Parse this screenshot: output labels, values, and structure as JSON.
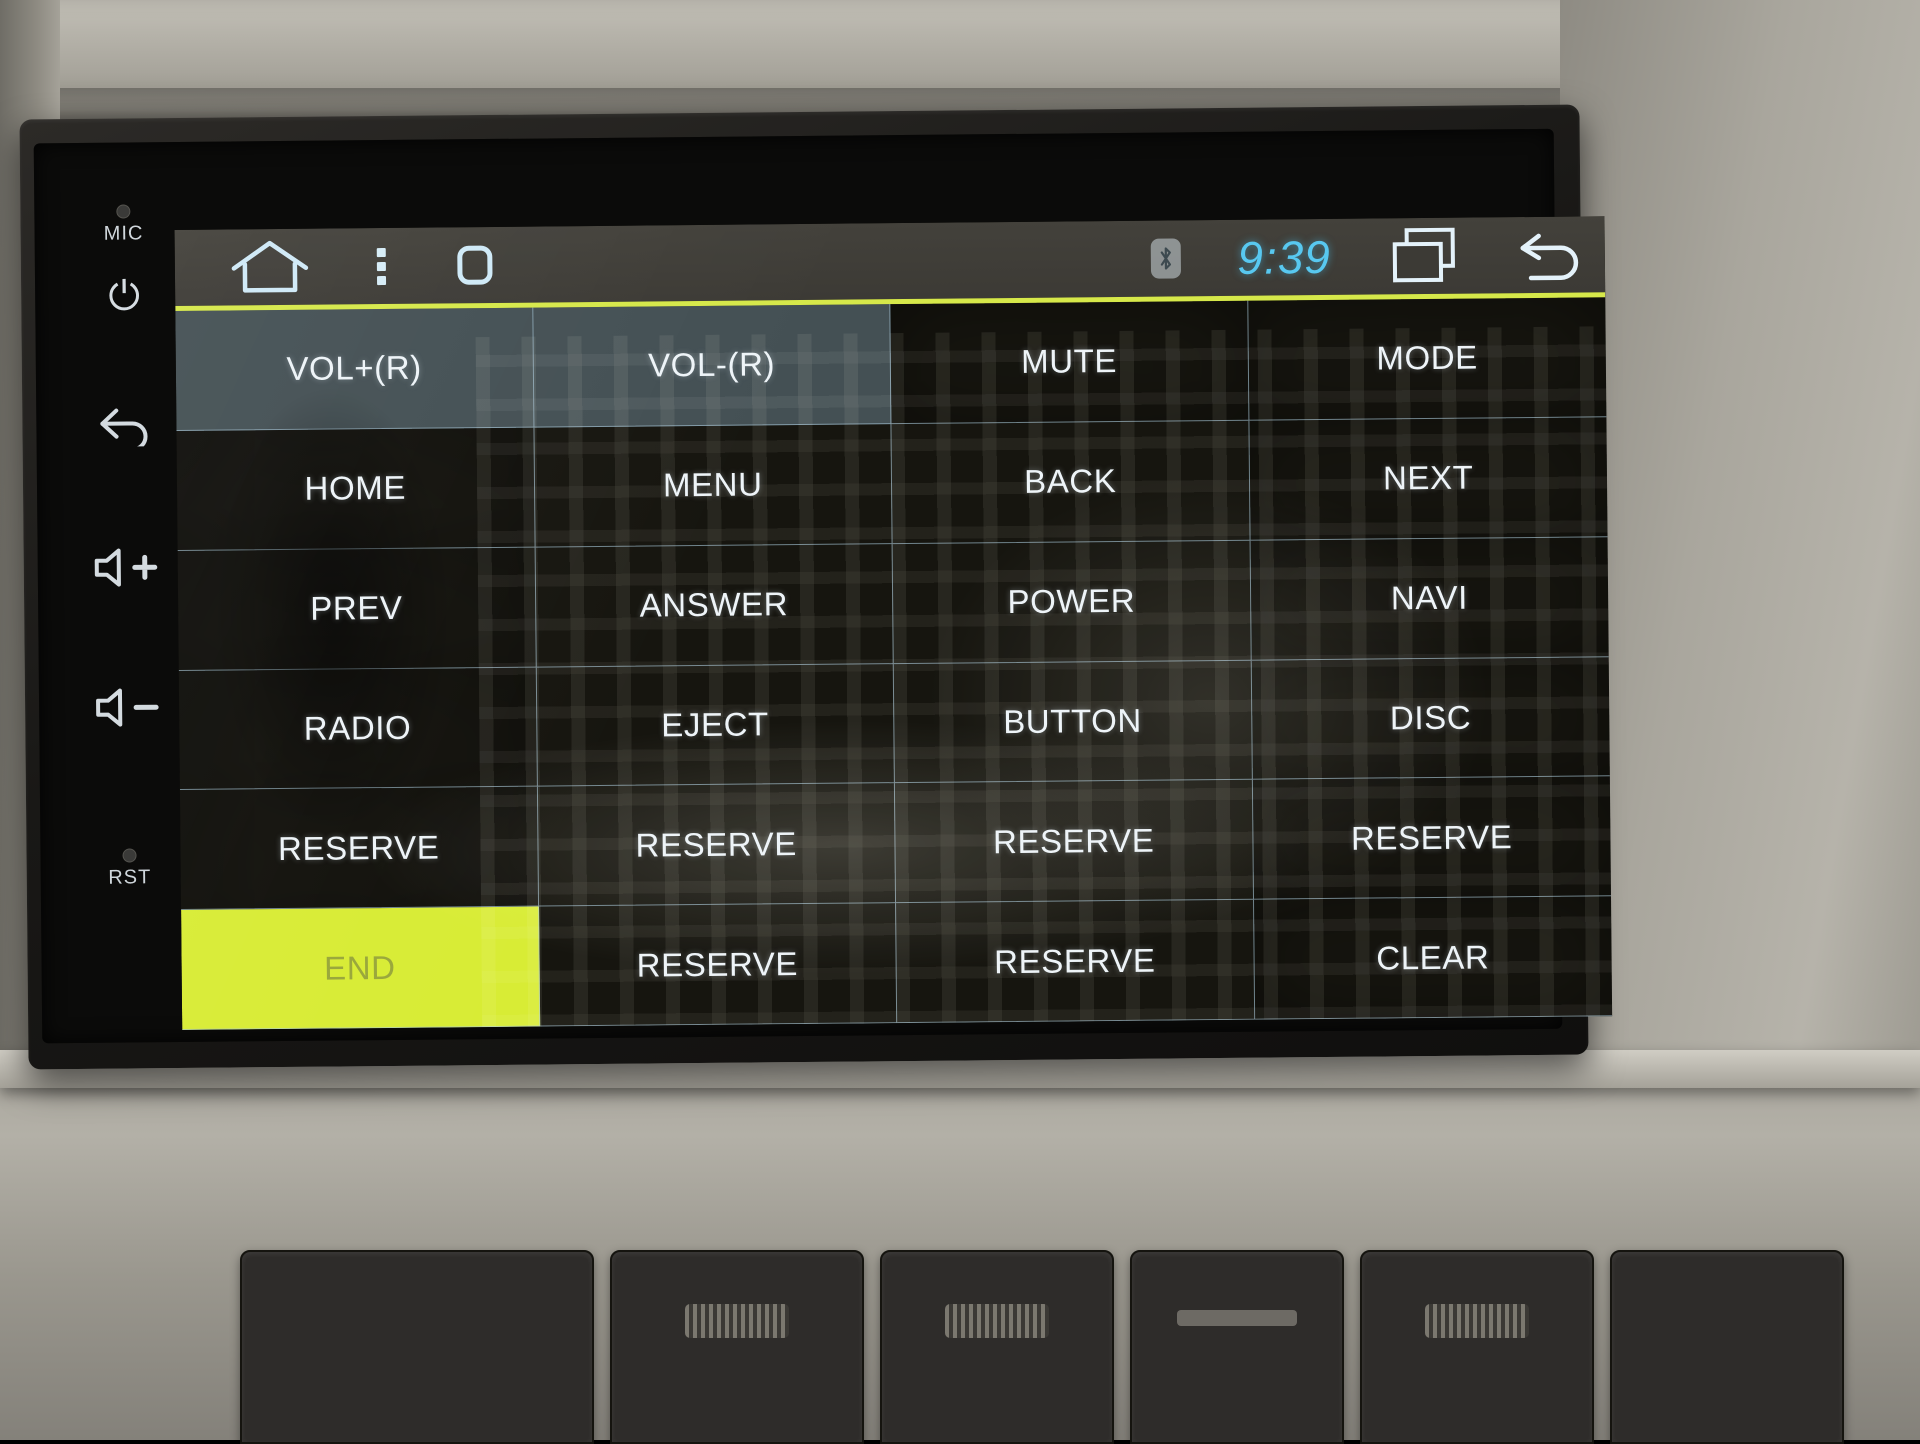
{
  "device": {
    "name": "car-head-unit",
    "accent_color": "#d6e84a",
    "selected_cell_color": "#96bad0",
    "active_cell_color": "#d8ec35"
  },
  "hard_keys": [
    {
      "label": "MIC",
      "icon": "microphone-icon",
      "glyph": ""
    },
    {
      "label": "",
      "icon": "power-icon",
      "glyph": "⏻"
    },
    {
      "label": "",
      "icon": "back-arrow-icon",
      "glyph": "↩"
    },
    {
      "label": "",
      "icon": "volume-up-icon",
      "glyph": "+"
    },
    {
      "label": "",
      "icon": "volume-down-icon",
      "glyph": "−"
    },
    {
      "label": "RST",
      "icon": "reset-pinhole-icon",
      "glyph": ""
    }
  ],
  "statusbar": {
    "left_icons": [
      {
        "name": "home-icon",
        "label": "Home"
      },
      {
        "name": "overflow-menu-icon",
        "label": "Menu"
      },
      {
        "name": "stop-square-icon",
        "label": "Recents"
      }
    ],
    "bluetooth_label": "Bluetooth",
    "time": "9:39",
    "right_icons": [
      {
        "name": "recent-apps-icon",
        "label": "Recent apps"
      },
      {
        "name": "back-icon",
        "label": "Back"
      }
    ]
  },
  "grid": {
    "columns": 4,
    "rows": 6,
    "cells": [
      {
        "label": "VOL+(R)",
        "state": "selected"
      },
      {
        "label": "VOL-(R)",
        "state": "selected"
      },
      {
        "label": "MUTE",
        "state": "normal"
      },
      {
        "label": "MODE",
        "state": "normal"
      },
      {
        "label": "HOME",
        "state": "normal"
      },
      {
        "label": "MENU",
        "state": "normal"
      },
      {
        "label": "BACK",
        "state": "normal"
      },
      {
        "label": "NEXT",
        "state": "normal"
      },
      {
        "label": "PREV",
        "state": "normal"
      },
      {
        "label": "ANSWER",
        "state": "normal"
      },
      {
        "label": "POWER",
        "state": "normal"
      },
      {
        "label": "NAVI",
        "state": "normal"
      },
      {
        "label": "RADIO",
        "state": "normal"
      },
      {
        "label": "EJECT",
        "state": "normal"
      },
      {
        "label": "BUTTON",
        "state": "normal"
      },
      {
        "label": "DISC",
        "state": "normal"
      },
      {
        "label": "RESERVE",
        "state": "normal"
      },
      {
        "label": "RESERVE",
        "state": "normal"
      },
      {
        "label": "RESERVE",
        "state": "normal"
      },
      {
        "label": "RESERVE",
        "state": "normal"
      },
      {
        "label": "END",
        "state": "active"
      },
      {
        "label": "RESERVE",
        "state": "normal"
      },
      {
        "label": "RESERVE",
        "state": "normal"
      },
      {
        "label": "CLEAR",
        "state": "normal"
      }
    ]
  }
}
